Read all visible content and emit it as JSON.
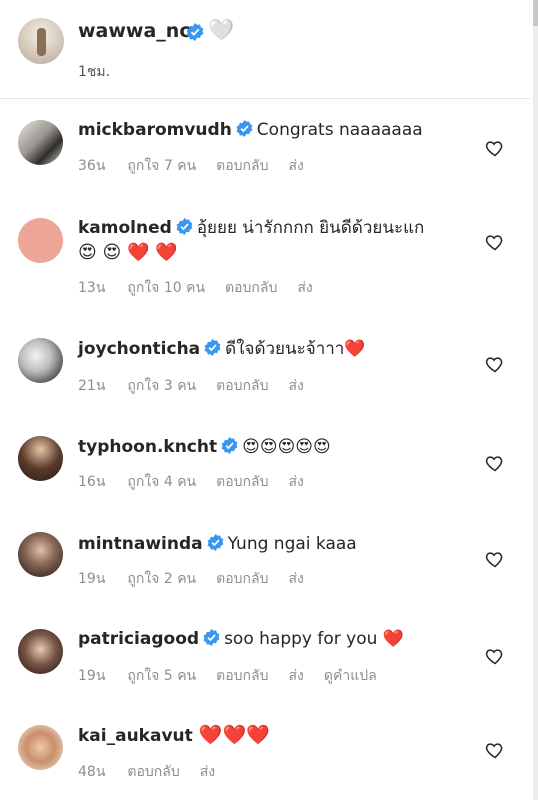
{
  "post": {
    "username": "wawwa_nc",
    "caption": "🤍",
    "time": "1ชม."
  },
  "colors": {
    "verified": "#3897f0",
    "meta_text": "#8e8e8e",
    "heart_red": "#e0245e"
  },
  "comments": [
    {
      "username": "mickbaromvudh",
      "text": "Congrats naaaaaaa",
      "text2": "",
      "time": "36น",
      "likes": "ถูกใจ 7 คน",
      "reply": "ตอบกลับ",
      "send": "ส่ง",
      "translate": ""
    },
    {
      "username": "kamolned",
      "text": "อุ้ยยย น่ารักกกก ยินดีด้วยนะแก",
      "text2": "😍 😍 ❤️ ❤️",
      "time": "13น",
      "likes": "ถูกใจ 10 คน",
      "reply": "ตอบกลับ",
      "send": "ส่ง",
      "translate": ""
    },
    {
      "username": "joychonticha",
      "text": "ดีใจด้วยนะจ้าาา❤️",
      "text2": "",
      "time": "21น",
      "likes": "ถูกใจ 3 คน",
      "reply": "ตอบกลับ",
      "send": "ส่ง",
      "translate": ""
    },
    {
      "username": "typhoon.kncht",
      "text": "😍😍😍😍😍",
      "text2": "",
      "time": "16น",
      "likes": "ถูกใจ 4 คน",
      "reply": "ตอบกลับ",
      "send": "ส่ง",
      "translate": ""
    },
    {
      "username": "mintnawinda",
      "text": "Yung ngai kaaa",
      "text2": "",
      "time": "19น",
      "likes": "ถูกใจ 2 คน",
      "reply": "ตอบกลับ",
      "send": "ส่ง",
      "translate": ""
    },
    {
      "username": "patriciagood",
      "text": "soo happy for you ❤️",
      "text2": "",
      "time": "19น",
      "likes": "ถูกใจ 5 คน",
      "reply": "ตอบกลับ",
      "send": "ส่ง",
      "translate": "ดูคำแปล"
    },
    {
      "username": "kai_aukavut",
      "text": "❤️❤️❤️",
      "text2": "",
      "time": "48น",
      "likes": "",
      "reply": "ตอบกลับ",
      "send": "ส่ง",
      "translate": ""
    }
  ]
}
